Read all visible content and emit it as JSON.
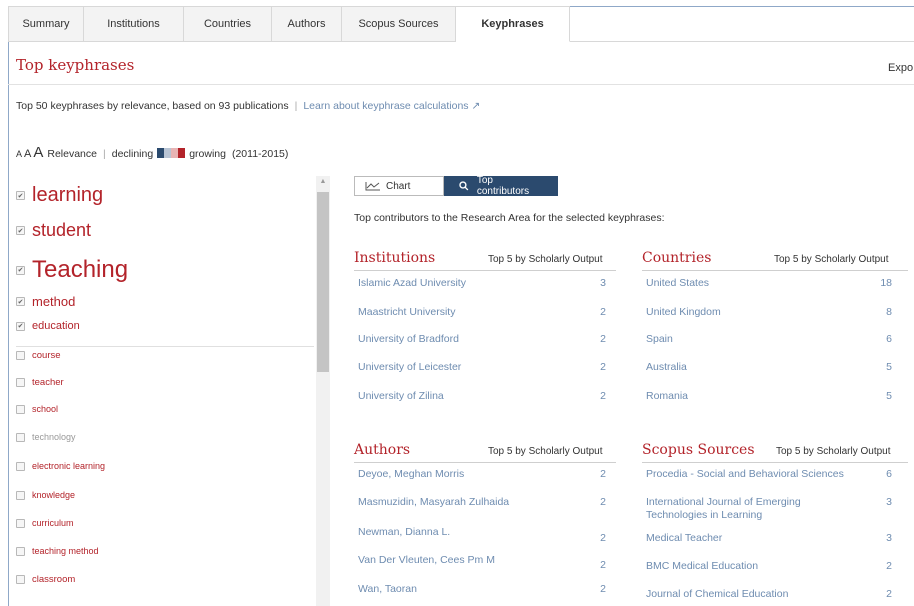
{
  "tabs": [
    "Summary",
    "Institutions",
    "Countries",
    "Authors",
    "Scopus Sources",
    "Keyphrases"
  ],
  "active_tab": "Keyphrases",
  "page_title": "Top keyphrases",
  "export_label": "Expo",
  "description": {
    "text": "Top 50 keyphrases by relevance, based on 93 publications",
    "link": "Learn about keyphrase calculations ↗"
  },
  "legend": {
    "a_small": "A",
    "a_mid": "A",
    "a_large": "A",
    "relevance": "Relevance",
    "declining": "declining",
    "growing": "growing",
    "years": "(2011-2015)",
    "colors": [
      "#2b4a6e",
      "#b8c4d4",
      "#e8b4b4",
      "#b3232a"
    ]
  },
  "keyphrases": [
    {
      "label": "learning",
      "checked": true
    },
    {
      "label": "student",
      "checked": true
    },
    {
      "label": "Teaching",
      "checked": true
    },
    {
      "label": "method",
      "checked": true
    },
    {
      "label": "education",
      "checked": true
    },
    {
      "label": "course",
      "checked": false
    },
    {
      "label": "teacher",
      "checked": false
    },
    {
      "label": "school",
      "checked": false
    },
    {
      "label": "technology",
      "checked": false
    },
    {
      "label": "electronic learning",
      "checked": false
    },
    {
      "label": "knowledge",
      "checked": false
    },
    {
      "label": "curriculum",
      "checked": false
    },
    {
      "label": "teaching method",
      "checked": false
    },
    {
      "label": "classroom",
      "checked": false
    }
  ],
  "toggle": {
    "chart": "Chart",
    "contributors": "Top contributors"
  },
  "contrib_desc": "Top contributors to the Research Area for the selected keyphrases:",
  "panels": {
    "institutions": {
      "title": "Institutions",
      "subtitle": "Top 5 by Scholarly Output",
      "rows": [
        {
          "name": "Islamic Azad University",
          "value": "3"
        },
        {
          "name": "Maastricht University",
          "value": "2"
        },
        {
          "name": "University of Bradford",
          "value": "2"
        },
        {
          "name": "University of Leicester",
          "value": "2"
        },
        {
          "name": "University of Zilina",
          "value": "2"
        }
      ]
    },
    "countries": {
      "title": "Countries",
      "subtitle": "Top 5 by Scholarly Output",
      "rows": [
        {
          "name": "United States",
          "value": "18"
        },
        {
          "name": "United Kingdom",
          "value": "8"
        },
        {
          "name": "Spain",
          "value": "6"
        },
        {
          "name": "Australia",
          "value": "5"
        },
        {
          "name": "Romania",
          "value": "5"
        }
      ]
    },
    "authors": {
      "title": "Authors",
      "subtitle": "Top 5 by Scholarly Output",
      "rows": [
        {
          "name": "Deyoe, Meghan Morris",
          "value": "2"
        },
        {
          "name": "Masmuzidin, Masyarah Zulhaida",
          "value": "2"
        },
        {
          "name": "Newman, Dianna L.",
          "value": "2"
        },
        {
          "name": "Van Der Vleuten, Cees Pm M",
          "value": "2"
        },
        {
          "name": "Wan, Taoran",
          "value": "2"
        }
      ]
    },
    "sources": {
      "title": "Scopus Sources",
      "subtitle": "Top 5 by Scholarly Output",
      "rows": [
        {
          "name": "Procedia - Social and Behavioral Sciences",
          "value": "6"
        },
        {
          "name": "International Journal of Emerging",
          "name2": "Technologies in Learning",
          "value": "3"
        },
        {
          "name": "Medical Teacher",
          "value": "3"
        },
        {
          "name": "BMC Medical Education",
          "value": "2"
        },
        {
          "name": "Journal of Chemical Education",
          "value": "2"
        }
      ]
    }
  }
}
